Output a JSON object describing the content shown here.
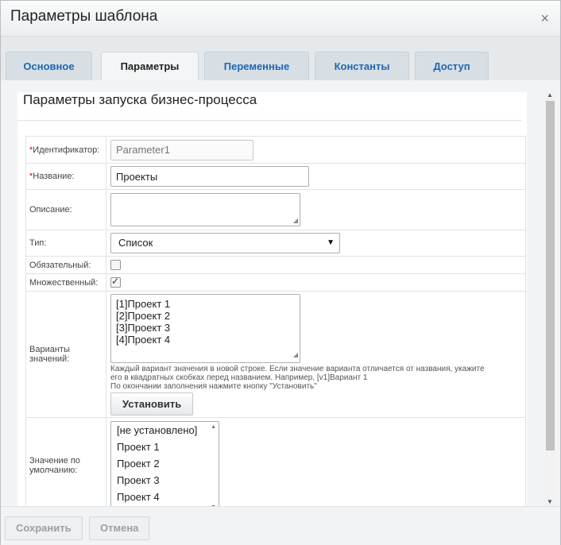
{
  "dialog": {
    "title": "Параметры шаблона",
    "close_glyph": "×"
  },
  "tabs": [
    {
      "label": "Основное"
    },
    {
      "label": "Параметры"
    },
    {
      "label": "Переменные"
    },
    {
      "label": "Константы"
    },
    {
      "label": "Доступ"
    }
  ],
  "active_tab": "Параметры",
  "section": {
    "title": "Параметры запуска бизнес-процесса"
  },
  "form": {
    "id": {
      "label": "Идентификатор:",
      "required": "*",
      "placeholder": "Parameter1"
    },
    "name": {
      "label": "Название:",
      "required": "*",
      "value": "Проекты"
    },
    "description": {
      "label": "Описание:",
      "value": ""
    },
    "type": {
      "label": "Тип:",
      "value": "Список"
    },
    "required_field": {
      "label": "Обязательный:",
      "checked": false
    },
    "multiple": {
      "label": "Множественный:",
      "checked": true,
      "check_glyph": "✓"
    },
    "options": {
      "label": "Варианты значений:",
      "lines": [
        "[1]Проект 1",
        "[2]Проект 2",
        "[3]Проект 3",
        "[4]Проект 4"
      ],
      "hint1": "Каждый вариант значения в новой строке. Если значение варианта отличается от названия, укажите его в квадратных скобках перед названием. Например, [v1]Вариант 1",
      "hint2": "По окончании заполнения нажмите кнопку \"Установить\"",
      "apply_button": "Установить"
    },
    "default": {
      "label": "Значение по умолчанию:",
      "items": [
        "[не установлено]",
        "Проект 1",
        "Проект 2",
        "Проект 3",
        "Проект 4"
      ]
    }
  },
  "footer": {
    "save": "Сохранить",
    "cancel": "Отмена"
  },
  "icons": {
    "close": "close-icon",
    "dropdown": "chevron-down-icon",
    "checkbox_mark": "check-icon"
  }
}
